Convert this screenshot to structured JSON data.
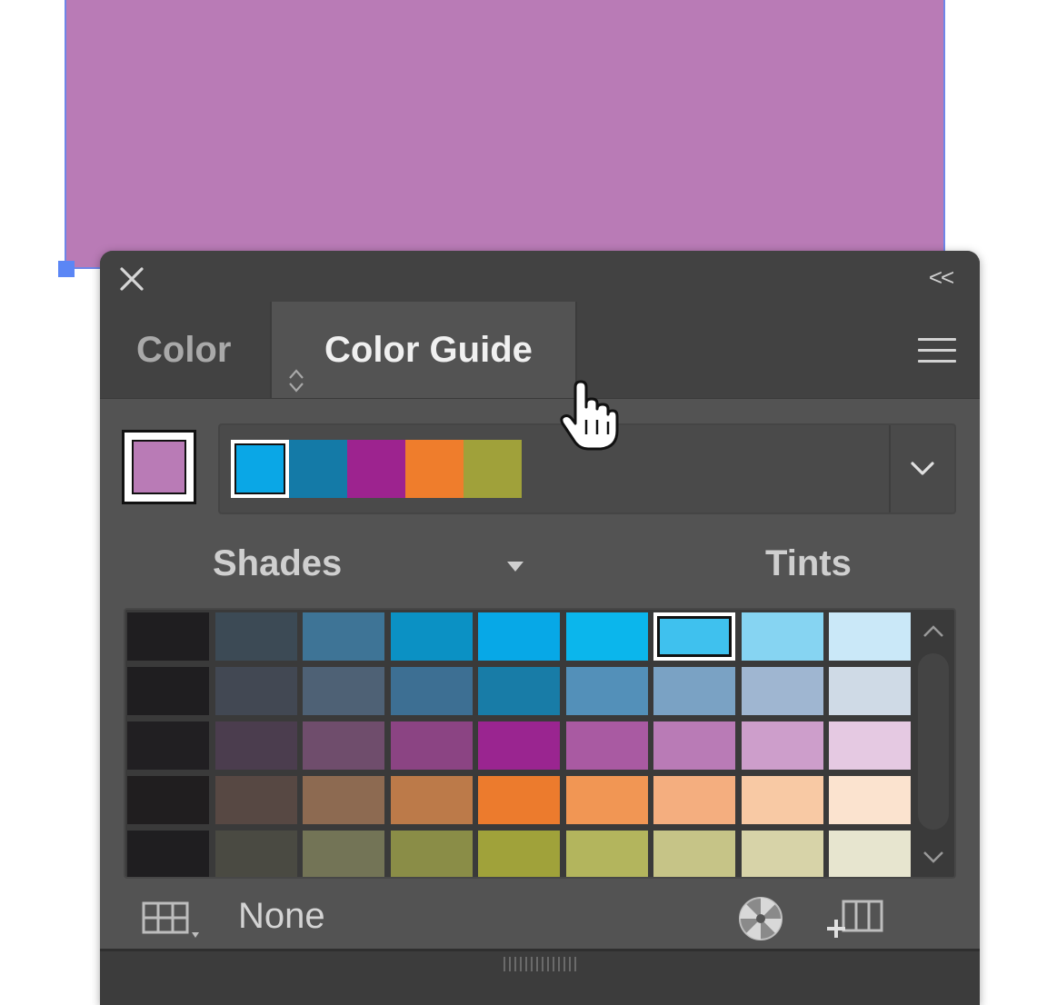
{
  "canvas": {
    "fill_color": "#b97bb6",
    "selection_color": "#6f86e8"
  },
  "panel": {
    "close_icon": "close-icon",
    "collapse_label": "<<",
    "tabs": [
      {
        "label": "Color",
        "active": false
      },
      {
        "label": "Color Guide",
        "active": true
      }
    ],
    "menu_icon": "hamburger-menu-icon"
  },
  "base_color": "#b97bb6",
  "harmony_colors": [
    "#0aa7e6",
    "#147aa7",
    "#9d238f",
    "#ef7d2c",
    "#a0a13a"
  ],
  "harmony_selected_index": 0,
  "variation": {
    "left_label": "Shades",
    "right_label": "Tints"
  },
  "grid": {
    "selected": {
      "row": 0,
      "col": 6
    },
    "rows": [
      [
        "#1f1e20",
        "#3c4a55",
        "#3e7496",
        "#0b91c4",
        "#07a8e7",
        "#0bb6ec",
        "#3fc1ee",
        "#86d4f2",
        "#cae8f8"
      ],
      [
        "#1f1e20",
        "#424853",
        "#4e6175",
        "#3d6f93",
        "#187ca7",
        "#5390b9",
        "#7aa2c4",
        "#9fb6d1",
        "#cfdae6"
      ],
      [
        "#211f22",
        "#4b3d4e",
        "#6f4d6c",
        "#8b4483",
        "#9a2590",
        "#a95aa2",
        "#b97bb6",
        "#cd9ecb",
        "#e5c9e2"
      ],
      [
        "#201e1f",
        "#574843",
        "#8d6a51",
        "#bc7a49",
        "#ec7b2d",
        "#f19654",
        "#f4ae7f",
        "#f8c9a4",
        "#fbe3cf"
      ],
      [
        "#1f1e20",
        "#4a4a42",
        "#737456",
        "#8a8d47",
        "#a0a23a",
        "#b3b55d",
        "#c6c487",
        "#d7d3a8",
        "#e7e5cf"
      ]
    ]
  },
  "footer": {
    "grid_view_icon": "grid-view-icon",
    "value": "None",
    "color_wheel_icon": "color-wheel-icon",
    "save_group_icon": "save-color-group-icon"
  }
}
